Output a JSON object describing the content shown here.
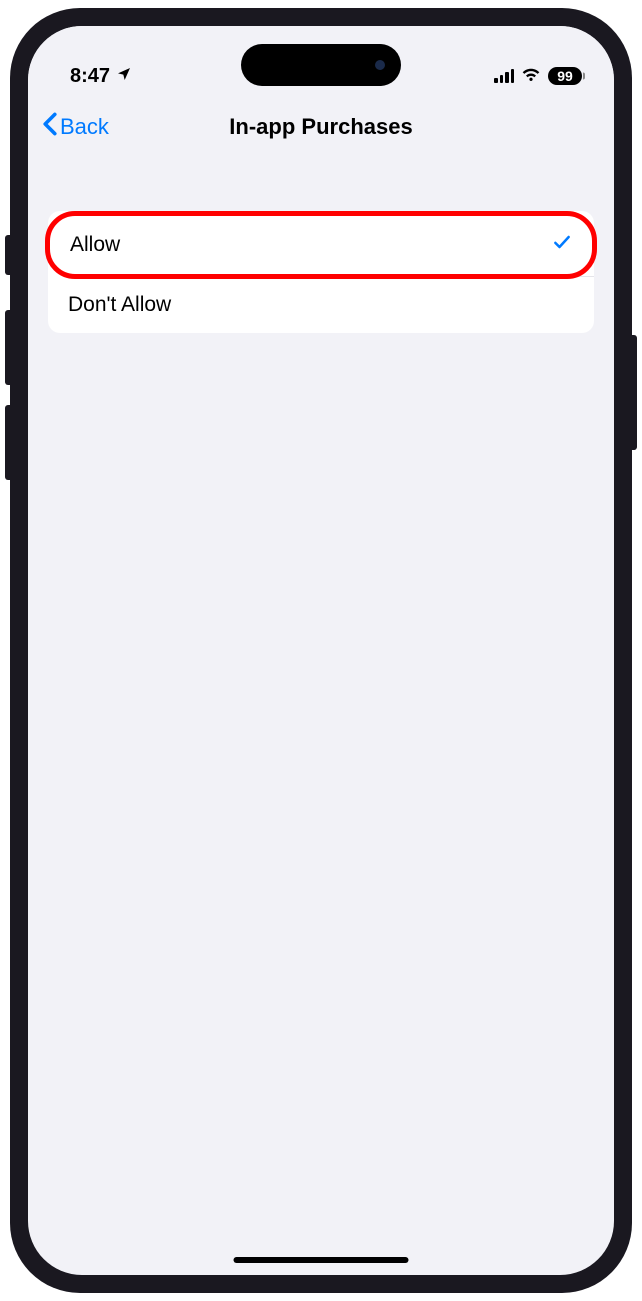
{
  "status": {
    "time": "8:47",
    "battery": "99"
  },
  "nav": {
    "back_label": "Back",
    "title": "In-app Purchases"
  },
  "options": {
    "allow": "Allow",
    "dont_allow": "Don't Allow"
  }
}
